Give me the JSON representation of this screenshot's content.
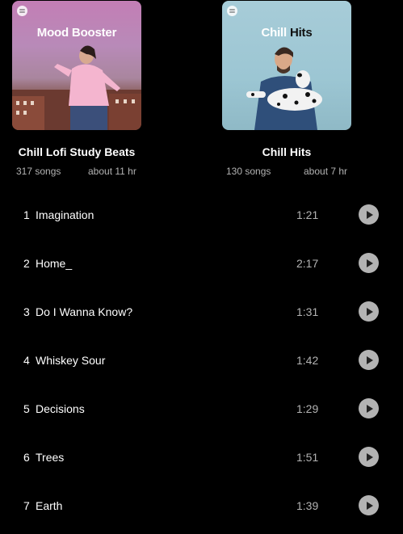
{
  "playlists": [
    {
      "cover_text": "Mood Booster",
      "title": "Chill Lofi Study Beats",
      "song_count": "317 songs",
      "duration": "about 11 hr"
    },
    {
      "cover_text_a": "Chill",
      "cover_text_b": "Hits",
      "title": "Chill Hits",
      "song_count": "130 songs",
      "duration": "about 7 hr"
    }
  ],
  "tracks": [
    {
      "num": "1",
      "name": "Imagination",
      "duration": "1:21"
    },
    {
      "num": "2",
      "name": "Home_",
      "duration": "2:17"
    },
    {
      "num": "3",
      "name": "Do I Wanna Know?",
      "duration": "1:31"
    },
    {
      "num": "4",
      "name": "Whiskey Sour",
      "duration": "1:42"
    },
    {
      "num": "5",
      "name": "Decisions",
      "duration": "1:29"
    },
    {
      "num": "6",
      "name": "Trees",
      "duration": "1:51"
    },
    {
      "num": "7",
      "name": "Earth",
      "duration": "1:39"
    }
  ],
  "icons": {
    "play": "play-icon",
    "brand": "spotify-logo-icon"
  }
}
